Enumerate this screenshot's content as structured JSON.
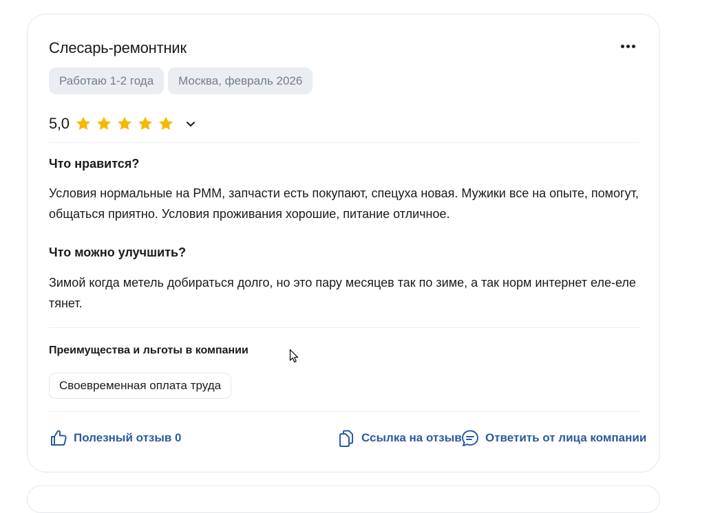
{
  "review": {
    "title": "Слесарь-ремонтник",
    "tags": [
      "Работаю 1-2 года",
      "Москва, февраль 2026"
    ],
    "rating": {
      "value_label": "5,0",
      "stars": 5,
      "max_stars": 5
    },
    "likes": {
      "heading": "Что нравится?",
      "text": "Условия нормальные на РММ, запчасти есть покупают, спецуха новая. Мужики все на опыте, помогут, общаться приятно. Условия проживания хорошие, питание отличное."
    },
    "improve": {
      "heading": "Что можно улучшить?",
      "text": "Зимой когда метель добираться долго, но это пару месяцев так по зиме, а так норм интернет еле-еле тянет."
    },
    "benefits": {
      "heading": "Преимущества и льготы в компании",
      "items": [
        "Своевременная оплата труда"
      ]
    },
    "actions": {
      "helpful": "Полезный отзыв 0",
      "link": "Ссылка на отзыв",
      "reply": "Ответить от лица компании"
    }
  },
  "colors": {
    "accent": "#2b5a9c",
    "star": "#f5b800",
    "chip_bg": "#eaedf2",
    "muted_text": "#767d88"
  },
  "icons": {
    "menu": "more-horizontal-icon",
    "star": "star-icon",
    "expand": "chevron-down-icon",
    "helpful": "thumbs-up-icon",
    "link": "copy-link-icon",
    "reply": "chat-bubble-icon"
  }
}
